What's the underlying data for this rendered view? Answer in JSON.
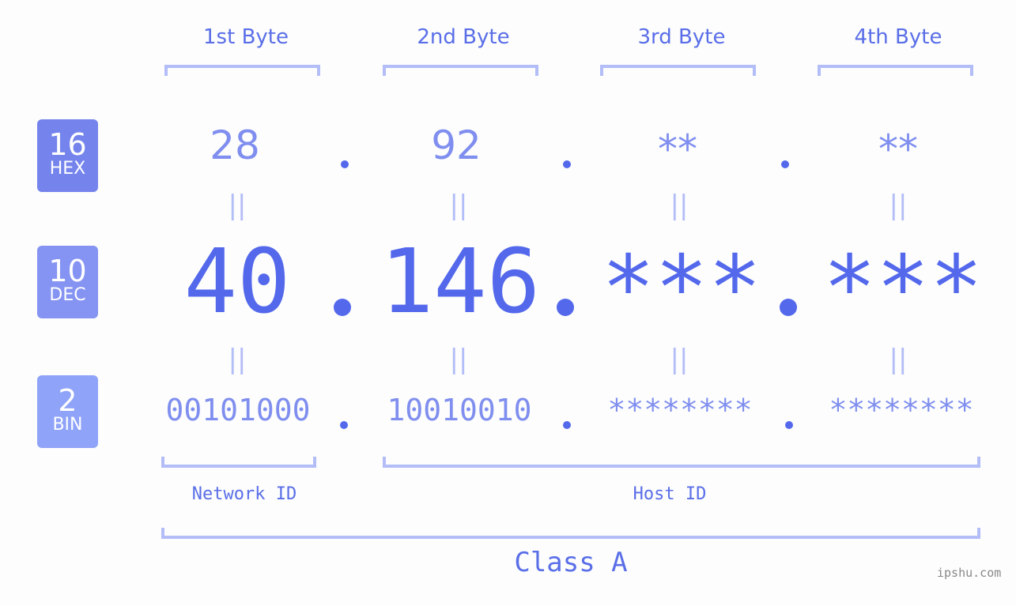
{
  "bytes": [
    {
      "label": "1st Byte",
      "hex": "28",
      "dec": "40",
      "bin": "00101000"
    },
    {
      "label": "2nd Byte",
      "hex": "92",
      "dec": "146",
      "bin": "10010010"
    },
    {
      "label": "3rd Byte",
      "hex": "**",
      "dec": "***",
      "bin": "********"
    },
    {
      "label": "4th Byte",
      "hex": "**",
      "dec": "***",
      "bin": "********"
    }
  ],
  "badges": {
    "hex": {
      "num": "16",
      "label": "HEX",
      "color": "#7584ec"
    },
    "dec": {
      "num": "10",
      "label": "DEC",
      "color": "#8594f2"
    },
    "bin": {
      "num": "2",
      "label": "BIN",
      "color": "#8fa3f8"
    }
  },
  "equals_sign": "||",
  "network_label": "Network ID",
  "host_label": "Host ID",
  "class_label": "Class A",
  "watermark": "ipshu.com",
  "colors": {
    "accent": "#5468ec",
    "light": "#7f8eef",
    "bracket": "#b3bdf7"
  }
}
